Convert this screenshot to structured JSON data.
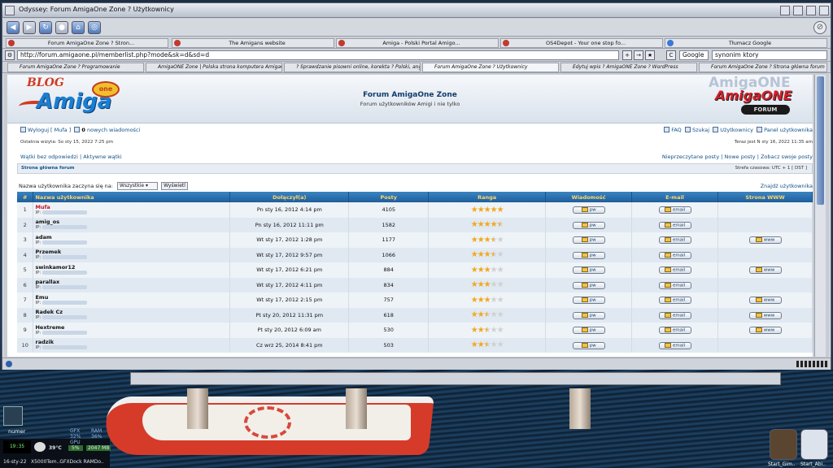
{
  "window": {
    "title": "Odyssey: Forum AmigaOne Zone ? Użytkownicy"
  },
  "navbar": {
    "back": "◀",
    "forward": "▶",
    "reload": "↻",
    "stop": "●",
    "home": "⌂",
    "bookmarks": "◎"
  },
  "tabs_row1": [
    {
      "label": "Forum AmigaOne Zone ? Stron...",
      "icon_color": "#c3392f"
    },
    {
      "label": "The Amigans website",
      "icon_color": "#c3392f"
    },
    {
      "label": "Amiga - Polski Portal Amigo...",
      "icon_color": "#c3392f"
    },
    {
      "label": "OS4Depot - Your one stop fo...",
      "icon_color": "#a8242b"
    },
    {
      "label": "Tłumacz Google",
      "icon_color": "#3b78d8"
    }
  ],
  "url": {
    "value": "http://forum.amigaone.pl/memberlist.php?mode&sk=d&sd=d",
    "search_engine": "Google",
    "search_value": "synonim ktory"
  },
  "tabs_row2": [
    "Forum AmigaOne Zone ? Programowanie",
    "AmigaONE Zone | Polska strona komputera AmigaOn",
    "? Sprawdzanie pisowni online, korekta ? Polski, angiel",
    "Forum AmigaOne Zone ? Użytkownicy",
    "Edytuj wpis ? AmigaONE Zone ? WordPress",
    "Forum AmigaOne Zone ? Strona główna forum"
  ],
  "header": {
    "blog": "BLOG",
    "amiga": "Amiga",
    "one": "one",
    "title": "Forum AmigaOne Zone",
    "subtitle": "Forum użytkowników Amigi i nie tylko",
    "amigaone": "AmigaONE",
    "forum": "FORUM"
  },
  "userbar": {
    "logout": "Wyloguj [ Mufa ]",
    "messages_count": "0",
    "messages_label": "nowych wiadomości",
    "faq": "FAQ",
    "search": "Szukaj",
    "users": "Użytkownicy",
    "panel": "Panel użytkownika",
    "last_visit": "Ostatnia wizyta: So sty 15, 2022 7:25 pm",
    "now": "Teraz jest N sty 16, 2022 11:35 am",
    "unanswered": "Wątki bez odpowiedzi",
    "active": "Aktywne wątki",
    "unread": "Nieprzeczytane posty",
    "new_posts": "Nowe posty",
    "own_posts": "Zobacz swoje posty",
    "breadcrumb": "Strona główna forum",
    "timezone": "Strefa czasowa: UTC + 1 [ DST ]"
  },
  "filter": {
    "label": "Nazwa użytkownika zaczyna się na:",
    "select": "Wszystkie",
    "button": "Wyświetl",
    "find": "Znajdź użytkownika"
  },
  "table": {
    "headers": [
      "#",
      "Nazwa użytkownika",
      "Dołączył(a)",
      "Posty",
      "Ranga",
      "Wiadomość",
      "E-mail",
      "Strona WWW"
    ],
    "ip_label": "IP:",
    "pm_label": "pw",
    "email_label": "email",
    "www_label": "www",
    "rows": [
      {
        "n": "1",
        "name": "Mufa",
        "admin": true,
        "joined": "Pn sty 16, 2012 4:14 pm",
        "posts": "4105",
        "rank": 5,
        "www": false
      },
      {
        "n": "2",
        "name": "amig_os",
        "admin": false,
        "joined": "Pn sty 16, 2012 11:11 pm",
        "posts": "1582",
        "rank": 4.5,
        "www": false
      },
      {
        "n": "3",
        "name": "adam",
        "admin": false,
        "joined": "Wt sty 17, 2012 1:28 pm",
        "posts": "1177",
        "rank": 3.5,
        "www": true
      },
      {
        "n": "4",
        "name": "Przemek",
        "admin": false,
        "joined": "Wt sty 17, 2012 9:57 pm",
        "posts": "1066",
        "rank": 3.5,
        "www": false
      },
      {
        "n": "5",
        "name": "swinkamor12",
        "admin": false,
        "joined": "Wt sty 17, 2012 6:21 pm",
        "posts": "884",
        "rank": 3,
        "www": true
      },
      {
        "n": "6",
        "name": "parallax",
        "admin": false,
        "joined": "Wt sty 17, 2012 4:11 pm",
        "posts": "834",
        "rank": 3,
        "www": false
      },
      {
        "n": "7",
        "name": "Emu",
        "admin": false,
        "joined": "Wt sty 17, 2012 2:15 pm",
        "posts": "757",
        "rank": 3,
        "www": true
      },
      {
        "n": "8",
        "name": "Radek Cz",
        "admin": false,
        "joined": "Pt sty 20, 2012 11:31 pm",
        "posts": "618",
        "rank": 2.5,
        "www": true
      },
      {
        "n": "9",
        "name": "Hextreme",
        "admin": false,
        "joined": "Pt sty 20, 2012 6:09 am",
        "posts": "530",
        "rank": 2.5,
        "www": true
      },
      {
        "n": "10",
        "name": "radzik",
        "admin": false,
        "joined": "Cz wrz 25, 2014 8:41 pm",
        "posts": "503",
        "rank": 2.5,
        "www": false
      }
    ]
  },
  "desktop": {
    "volume_label": "numer",
    "clock": "19:35",
    "temp": "39°C",
    "gfx_label": "GFX",
    "gfx_value": "32%",
    "gpu_label": "GPU",
    "gpu_value": "5%",
    "ram_label": "RAM",
    "ram_value": "36%",
    "ram_mb": "2047 MB",
    "date": "16-sty-22",
    "bottom_text": "X5000Tem..GFXDock RAMDo..",
    "dock1": "Start_Gim..",
    "dock2": "Start_Abi.."
  }
}
